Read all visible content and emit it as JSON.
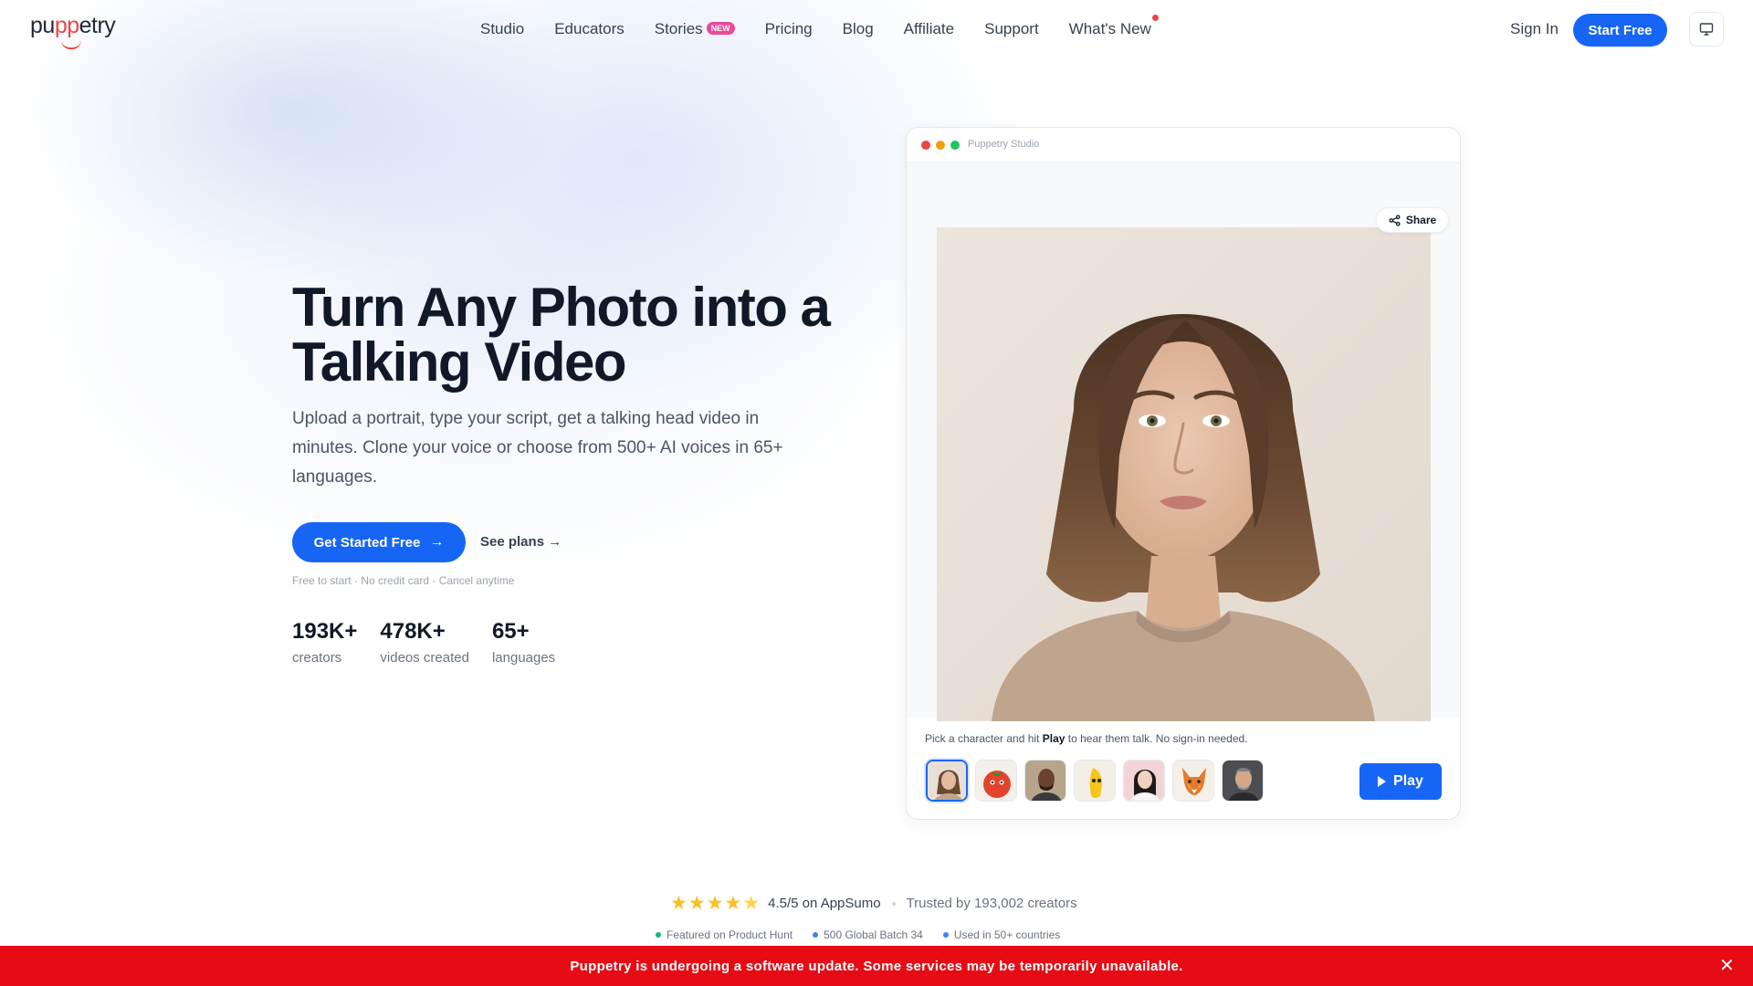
{
  "nav": {
    "logo": {
      "pre": "pu",
      "accent": "pp",
      "post": "etry"
    },
    "links": [
      {
        "label": "Studio"
      },
      {
        "label": "Educators"
      },
      {
        "label": "Stories",
        "badge": "NEW"
      },
      {
        "label": "Pricing"
      },
      {
        "label": "Blog"
      },
      {
        "label": "Affiliate"
      },
      {
        "label": "Support"
      },
      {
        "label": "What's New"
      }
    ],
    "sign_in": "Sign In",
    "start_free": "Start Free",
    "display_icon": "monitor-icon"
  },
  "hero": {
    "title": "Turn Any Photo into a Talking Video",
    "subtitle": "Upload a portrait, type your script, get a talking head video in minutes. Clone your voice or choose from 500+ AI voices in 65+ languages.",
    "cta": "Get Started Free",
    "secondary_link": "See plans →",
    "fine_print": "Free to start · No credit card · Cancel anytime",
    "stats": [
      {
        "value": "193K+",
        "label": "creators"
      },
      {
        "value": "478K+",
        "label": "videos created"
      },
      {
        "value": "65+",
        "label": "languages"
      }
    ]
  },
  "studio": {
    "window_title": "Puppetry Studio",
    "share_label": "Share",
    "hint_before": "Pick a character and hit ",
    "hint_bold": "Play",
    "hint_after": " to hear them talk. No sign-in needed.",
    "characters": [
      "woman-portrait",
      "tomato-character",
      "man-portrait",
      "banana-character",
      "asian-woman-portrait",
      "fox-character",
      "older-man-portrait"
    ],
    "selected_character": "woman-portrait",
    "play_label": "Play"
  },
  "social_proof": {
    "rating": "4.5/5 on AppSumo",
    "stars": 4.5,
    "trusted": "Trusted by 193,002 creators",
    "badges": [
      {
        "label": "Featured on Product Hunt",
        "color": "#10b981"
      },
      {
        "label": "500 Global Batch 34",
        "color": "#3b82f6"
      },
      {
        "label": "Used in 50+ countries",
        "color": "#3b82f6"
      }
    ]
  },
  "banner": {
    "message": "Puppetry is undergoing a software update. Some services may be temporarily unavailable.",
    "close_icon": "close-icon"
  },
  "colors": {
    "primary": "#1665f5",
    "banner": "#e60b14",
    "accent": "#ef4444",
    "badge_new": "#ec4899"
  }
}
